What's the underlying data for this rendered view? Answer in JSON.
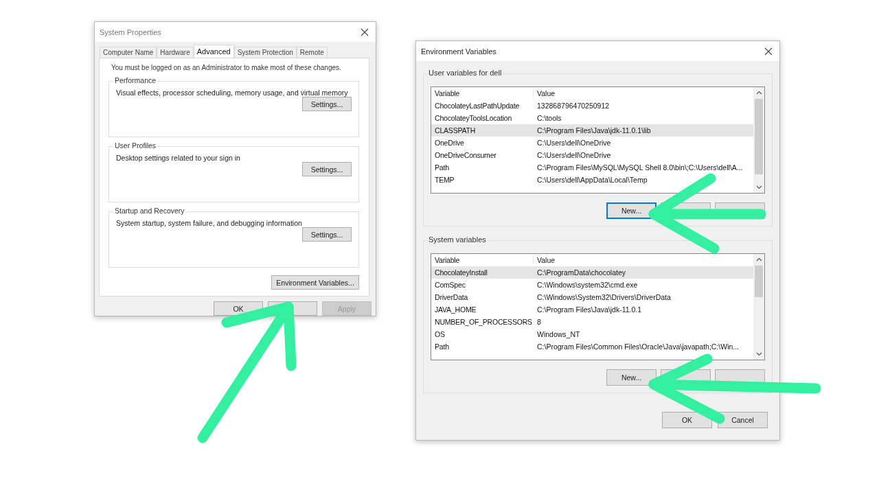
{
  "system_properties": {
    "title": "System Properties",
    "tabs": [
      {
        "label": "Computer Name",
        "selected": false
      },
      {
        "label": "Hardware",
        "selected": false
      },
      {
        "label": "Advanced",
        "selected": true
      },
      {
        "label": "System Protection",
        "selected": false
      },
      {
        "label": "Remote",
        "selected": false
      }
    ],
    "notice": "You must be logged on as an Administrator to make most of these changes.",
    "groups": [
      {
        "title": "Performance",
        "description": "Visual effects, processor scheduling, memory usage, and virtual memory",
        "button": "Settings..."
      },
      {
        "title": "User Profiles",
        "description": "Desktop settings related to your sign in",
        "button": "Settings..."
      },
      {
        "title": "Startup and Recovery",
        "description": "System startup, system failure, and debugging information",
        "button": "Settings..."
      }
    ],
    "env_button": "Environment Variables...",
    "buttons": [
      {
        "label": "OK",
        "disabled": false
      },
      {
        "disabled": false
      },
      {
        "label": "Apply",
        "disabled": true
      }
    ]
  },
  "environment_variables": {
    "title": "Environment Variables",
    "sections": [
      {
        "title": "User variables for dell",
        "columns": [
          "Variable",
          "Value"
        ],
        "rows": [
          {
            "cells": [
              "ChocolateyLastPathUpdate",
              "132868796470250912"
            ],
            "selected": false
          },
          {
            "cells": [
              "ChocolateyToolsLocation",
              "C:\\tools"
            ],
            "selected": false
          },
          {
            "cells": [
              "CLASSPATH",
              "C:\\Program Files\\Java\\jdk-11.0.1\\lib"
            ],
            "selected": true
          },
          {
            "cells": [
              "OneDrive",
              "C:\\Users\\dell\\OneDrive"
            ],
            "selected": false
          },
          {
            "cells": [
              "OneDriveConsumer",
              "C:\\Users\\dell\\OneDrive"
            ],
            "selected": false
          },
          {
            "cells": [
              "Path",
              "C:\\Program Files\\MySQL\\MySQL Shell 8.0\\bin\\;C:\\Users\\dell\\A..."
            ],
            "selected": false
          },
          {
            "cells": [
              "TEMP",
              "C:\\Users\\dell\\AppData\\Local\\Temp"
            ],
            "selected": false
          }
        ],
        "buttons": [
          {
            "label": "New...",
            "focused": true
          },
          {
            "focused": false
          },
          {
            "focused": false
          }
        ]
      },
      {
        "title": "System variables",
        "columns": [
          "Variable",
          "Value"
        ],
        "rows": [
          {
            "cells": [
              "ChocolateyInstall",
              "C:\\ProgramData\\chocolatey"
            ],
            "selected": true
          },
          {
            "cells": [
              "ComSpec",
              "C:\\Windows\\system32\\cmd.exe"
            ],
            "selected": false
          },
          {
            "cells": [
              "DriverData",
              "C:\\Windows\\System32\\Drivers\\DriverData"
            ],
            "selected": false
          },
          {
            "cells": [
              "JAVA_HOME",
              "C:\\Program Files\\Java\\jdk-11.0.1"
            ],
            "selected": false
          },
          {
            "cells": [
              "NUMBER_OF_PROCESSORS",
              "8"
            ],
            "selected": false
          },
          {
            "cells": [
              "OS",
              "Windows_NT"
            ],
            "selected": false
          },
          {
            "cells": [
              "Path",
              "C:\\Program Files\\Common Files\\Oracle\\Java\\javapath;C:\\Win..."
            ],
            "selected": false
          }
        ],
        "buttons": [
          {
            "label": "New...",
            "focused": false
          },
          {
            "focused": false
          },
          {
            "focused": false
          }
        ]
      }
    ],
    "buttons": [
      {
        "label": "OK"
      },
      {
        "label": "Cancel"
      }
    ]
  }
}
